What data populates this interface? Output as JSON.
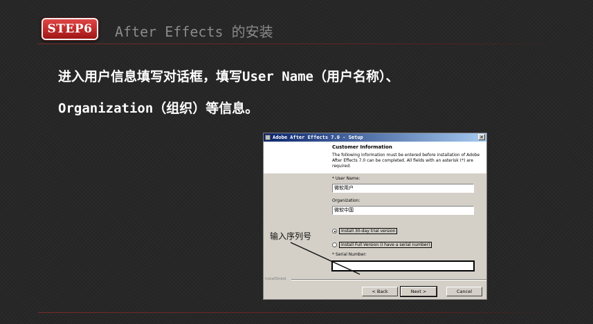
{
  "header": {
    "step_badge": "STEP6",
    "title": "After Effects 的安装"
  },
  "instruction": {
    "line1": "进入用户信息填写对话框，填写User Name（用户名称）、",
    "line2": "Organization（组织）等信息。"
  },
  "dialog": {
    "title": "Adobe After Effects 7.0 - Setup",
    "close_glyph": "✕",
    "heading": "Customer Information",
    "description": "The following information must be entered before installation of Adobe After Effects 7.0 can be completed. All fields with an asterisk (*) are required.",
    "user_name_label": "* User Name:",
    "user_name_value": "微软用户",
    "organization_label": "Organization:",
    "organization_value": "微软中国",
    "radio_trial": "Install 30-day trial version",
    "radio_full": "Install Full Version (I have a serial number)",
    "selected_option": "trial",
    "serial_label": "* Serial Number:",
    "serial_value": "",
    "installshield": "InstallShield",
    "buttons": {
      "back": "< Back",
      "next": "Next >",
      "cancel": "Cancel"
    }
  },
  "callout": {
    "text": "输入序列号"
  },
  "colors": {
    "badge": "#c62828",
    "background": "#262626",
    "titlebar": "#0a246a"
  }
}
